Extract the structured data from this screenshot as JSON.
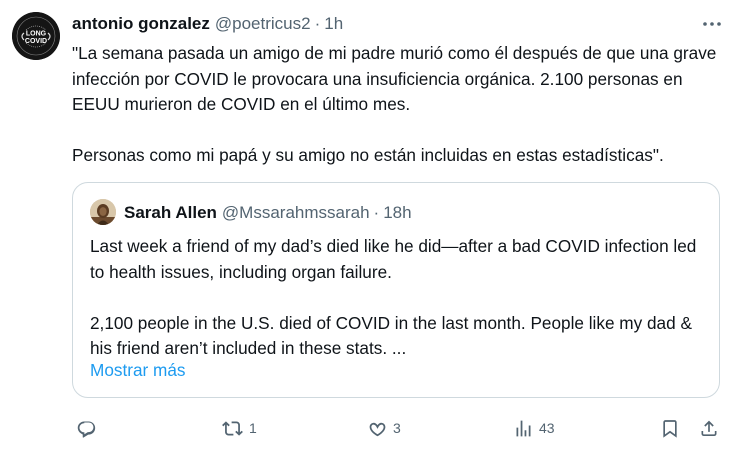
{
  "tweet": {
    "author": {
      "name": "antonio gonzalez",
      "handle": "@poetricus2",
      "separator": "·",
      "time": "1h",
      "avatar_text": {
        "top": "LONG",
        "bottom": "COVID"
      }
    },
    "text": [
      "\"La semana pasada un amigo de mi padre murió como él después de que una grave infección por COVID le provocara una insuficiencia orgánica. 2.100 personas en EEUU murieron de COVID en el último mes.",
      "Personas como mi papá y su amigo no están incluidas en estas estadísticas\"."
    ],
    "more_icon": "more-horizontal-icon"
  },
  "quoted_tweet": {
    "author": {
      "name": "Sarah Allen",
      "handle": "@Mssarahmssarah",
      "separator": "·",
      "time": "18h"
    },
    "text": [
      "Last week a friend of my dad’s died like he did—after a bad COVID infection led to health issues, including organ failure.",
      "2,100 people in the U.S. died of COVID in the last month. People like my dad & his friend aren’t included in these stats. ..."
    ],
    "show_more_label": "Mostrar más"
  },
  "actions": {
    "reply": {
      "icon": "reply-icon",
      "count": ""
    },
    "retweet": {
      "icon": "retweet-icon",
      "count": "1"
    },
    "like": {
      "icon": "heart-icon",
      "count": "3"
    },
    "views": {
      "icon": "views-icon",
      "count": "43"
    },
    "bookmark": {
      "icon": "bookmark-icon"
    },
    "share": {
      "icon": "share-icon"
    }
  },
  "colors": {
    "text_primary": "#0f1419",
    "text_secondary": "#536471",
    "link": "#1d9bf0",
    "border": "#cfd9de"
  }
}
